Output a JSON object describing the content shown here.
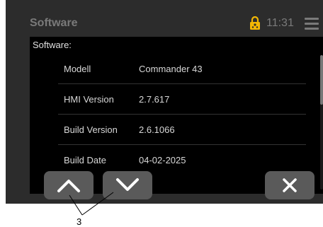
{
  "header": {
    "title": "Software",
    "time": "11:31",
    "lock_icon": "padlock-icon",
    "menu_icon": "hamburger-menu-icon"
  },
  "section_title": "Software:",
  "rows": [
    {
      "label": "Modell",
      "value": "Commander 43"
    },
    {
      "label": "HMI Version",
      "value": "2.7.617"
    },
    {
      "label": "Build Version",
      "value": "2.6.1066"
    },
    {
      "label": "Build Date",
      "value": "04-02-2025"
    }
  ],
  "buttons": {
    "up_icon": "chevron-up-icon",
    "down_icon": "chevron-down-icon",
    "close_icon": "close-icon"
  },
  "callout": {
    "number": "3"
  },
  "colors": {
    "frame": "#2c2c2c",
    "screen": "#000000",
    "button": "#5a5a5a",
    "lock_accent": "#f2b705"
  }
}
